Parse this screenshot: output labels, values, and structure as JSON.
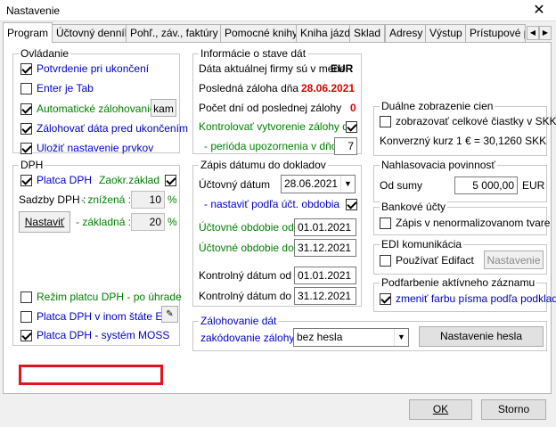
{
  "window": {
    "title": "Nastavenie",
    "close_glyph": "✕"
  },
  "tabs": [
    "Program",
    "Účtovný denník",
    "Pohľ., záv., faktúry",
    "Pomocné knihy",
    "Kniha jázd",
    "Sklad",
    "Adresy",
    "Výstup",
    "Prístupové pr"
  ],
  "tab_arrows": [
    "◀",
    "▶"
  ],
  "ovladanie": {
    "title": "Ovládanie",
    "potvrdenie": "Potvrdenie pri ukončení",
    "enter": "Enter je Tab",
    "auto_zal": "Automatické zálohovanie",
    "kam": "kam",
    "zal_data": "Zálohovať dáta pred ukončením",
    "ulozit": "Uložiť nastavenie prvkov"
  },
  "dph": {
    "title": "DPH",
    "platca": "Platca DPH",
    "zaokr": "Zaokr.základ",
    "sadzby": "Sadzby DPH :",
    "znizena_label": "- znížená :",
    "znizena_val": "10",
    "zakladna_label": "- základná :",
    "zakladna_val": "20",
    "pct": "%",
    "nastavit": "Nastaviť",
    "rezim": "Režim platcu DPH - po úhrade",
    "jinom": "Platca DPH v inom štáte EÚ",
    "moss": "Platca DPH - systém MOSS"
  },
  "info": {
    "title": "Informácie o stave dát",
    "mena_label": "Dáta aktuálnej firmy sú v mene",
    "mena_val": "EUR",
    "zaloha_label": "Posledná záloha dňa",
    "zaloha_val": "28.06.2021",
    "pocet_label": "Počet dní od poslednej zálohy",
    "pocet_val": "0",
    "kontrolovat": "Kontrolovať vytvorenie zálohy dát",
    "perioda_label": "- perióda upozornenia v dňoch",
    "perioda_val": "7"
  },
  "zapis": {
    "title": "Zápis dátumu do dokladov",
    "uctovny_label": "Účtovný dátum",
    "uctovny_val": "28.06.2021",
    "nastavit_label": "- nastaviť podľa účt. obdobia",
    "obdobie_od_label": "Účtovné obdobie od",
    "obdobie_od_val": "01.01.2021",
    "obdobie_do_label": "Účtovné obdobie do",
    "obdobie_do_val": "31.12.2021",
    "kontrol_od_label": "Kontrolný dátum od",
    "kontrol_od_val": "01.01.2021",
    "kontrol_do_label": "Kontrolný dátum do",
    "kontrol_do_val": "31.12.2021"
  },
  "dualne": {
    "title": "Duálne zobrazenie cien",
    "zobrazovat": "zobrazovať celkové čiastky v SKK",
    "kurz": "Konverzný kurz 1 € = 30,1260 SKK"
  },
  "nahlasovacia": {
    "title": "Nahlasovacia povinnosť",
    "od_sumy": "Od sumy",
    "suma_val": "5 000,00",
    "eur": "EUR"
  },
  "bankove": {
    "title": "Bankové účty",
    "zapis": "Zápis v nenormalizovanom tvare"
  },
  "edi": {
    "title": "EDI komunikácia",
    "pouzivat": "Používať Edifact",
    "nastavenie": "Nastavenie"
  },
  "podfarbenie": {
    "title": "Podfarbenie aktívneho záznamu",
    "zmenit": "zmeniť farbu písma podľa podkladu"
  },
  "zalohovanie": {
    "title": "Zálohovanie dát",
    "zakodovanie_label": "zakódovanie zálohy",
    "zakodovanie_val": "bez hesla",
    "nastavenie_hesla": "Nastavenie hesla"
  },
  "footer": {
    "ok": "OK",
    "storno": "Storno"
  },
  "colors": {
    "highlight": "#e0141e",
    "blue_text": "#0000c8",
    "green_text": "#008000",
    "red_text": "#e00000"
  }
}
